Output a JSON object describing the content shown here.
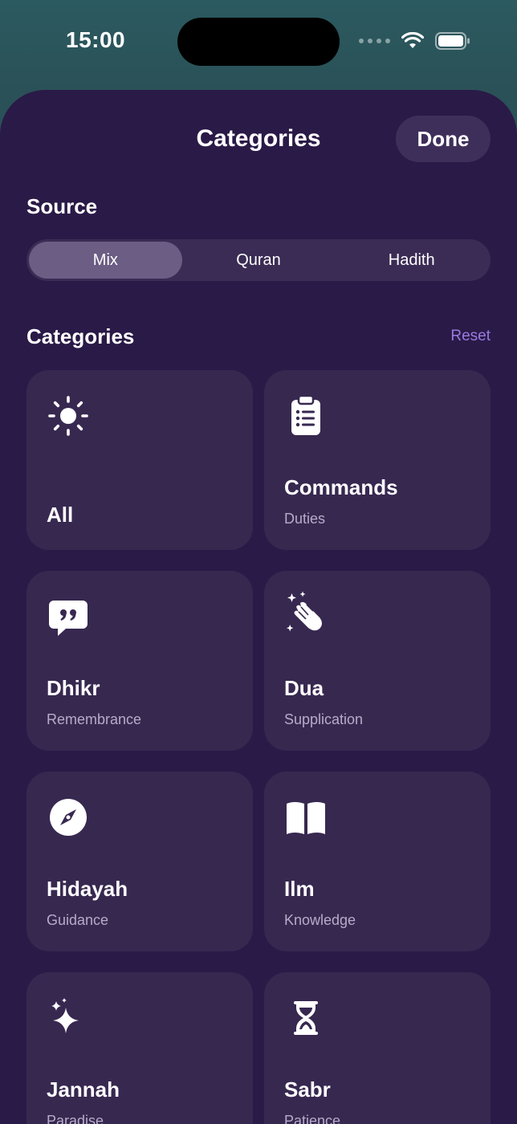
{
  "status_bar": {
    "time": "15:00",
    "icons": [
      "cellular-dots-icon",
      "wifi-icon",
      "battery-icon"
    ]
  },
  "header": {
    "title": "Categories",
    "done_label": "Done"
  },
  "source": {
    "label": "Source",
    "segments": [
      {
        "label": "Mix",
        "selected": true
      },
      {
        "label": "Quran",
        "selected": false
      },
      {
        "label": "Hadith",
        "selected": false
      }
    ]
  },
  "categories": {
    "label": "Categories",
    "reset_label": "Reset",
    "items": [
      {
        "title": "All",
        "subtitle": "",
        "icon": "sun-icon"
      },
      {
        "title": "Commands",
        "subtitle": "Duties",
        "icon": "clipboard-list-icon"
      },
      {
        "title": "Dhikr",
        "subtitle": "Remembrance",
        "icon": "quote-bubble-icon"
      },
      {
        "title": "Dua",
        "subtitle": "Supplication",
        "icon": "praying-hands-icon"
      },
      {
        "title": "Hidayah",
        "subtitle": "Guidance",
        "icon": "compass-icon"
      },
      {
        "title": "Ilm",
        "subtitle": "Knowledge",
        "icon": "book-icon"
      },
      {
        "title": "Jannah",
        "subtitle": "Paradise",
        "icon": "sparkles-icon"
      },
      {
        "title": "Sabr",
        "subtitle": "Patience",
        "icon": "hourglass-icon"
      }
    ]
  },
  "colors": {
    "sheet_bg": "#2a1a47",
    "card_bg": "#372850",
    "accent": "#9a7be0",
    "selected_segment": "#6b5d84"
  }
}
